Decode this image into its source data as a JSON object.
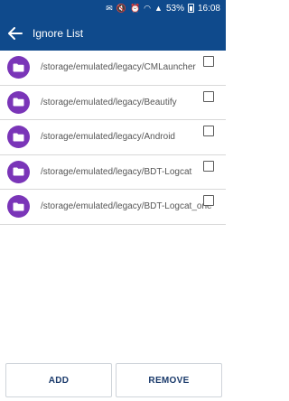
{
  "status_bar": {
    "battery": "53%",
    "time": "16:08"
  },
  "app_bar": {
    "title": "Ignore List",
    "back_icon": "arrow-left-icon"
  },
  "items": [
    {
      "path": "/storage/emulated/legacy/CMLauncher",
      "checked": false,
      "icon": "folder-icon"
    },
    {
      "path": "/storage/emulated/legacy/Beautify",
      "checked": false,
      "icon": "folder-icon"
    },
    {
      "path": "/storage/emulated/legacy/Android",
      "checked": false,
      "icon": "folder-icon"
    },
    {
      "path": "/storage/emulated/legacy/BDT-Logcat",
      "checked": false,
      "icon": "folder-icon"
    },
    {
      "path": "/storage/emulated/legacy/BDT-Logcat_one",
      "checked": false,
      "icon": "folder-icon"
    }
  ],
  "footer": {
    "add_label": "ADD",
    "remove_label": "REMOVE"
  },
  "colors": {
    "primary": "#0f4a8c",
    "folder_icon_bg": "#7a35b8",
    "button_text": "#1a3a6b"
  }
}
